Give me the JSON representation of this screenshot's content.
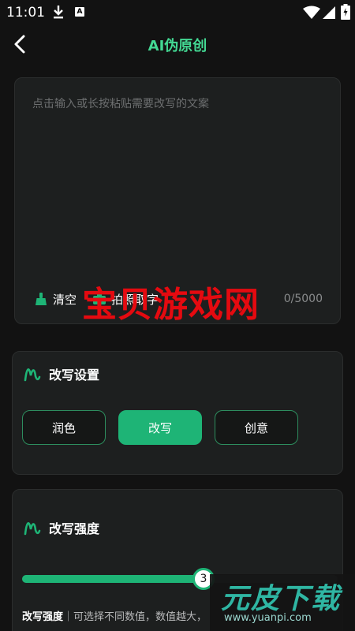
{
  "status_bar": {
    "time": "11:01",
    "notif_badge": "A"
  },
  "header": {
    "title": "AI伪原创"
  },
  "input": {
    "placeholder": "点击输入或长按粘贴需要改写的文案",
    "clear_label": "清空",
    "photo_label": "拍照取字",
    "counter": "0/5000"
  },
  "rewrite_settings": {
    "title": "改写设置",
    "modes": [
      "润色",
      "改写",
      "创意"
    ],
    "selected": "改写"
  },
  "strength": {
    "title": "改写强度",
    "value": 3,
    "max": 5,
    "desc_label": "改写强度",
    "desc_text": "｜可选择不同数值，数值越大，"
  },
  "watermarks": {
    "center": "宝贝游戏网",
    "logo": "元皮下载",
    "url": "www.yuanpi.com"
  },
  "colors": {
    "accent": "#1eb476",
    "title": "#43d893",
    "watermark": "#e50a10"
  }
}
